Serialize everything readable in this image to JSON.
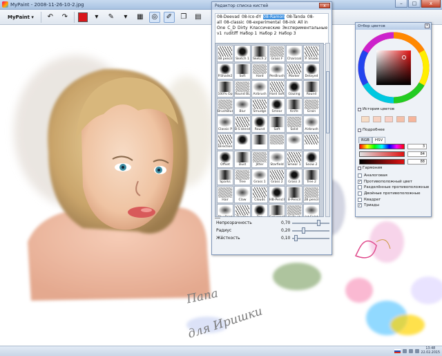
{
  "window": {
    "title": "MyPaint - 2008-11-26-10-2.jpg",
    "min": "–",
    "max": "□",
    "close": "x"
  },
  "toolbar": {
    "menu": "MyPaint ▾",
    "current_color": "#d9161b"
  },
  "canvas": {
    "line1": "Папа",
    "line2": "для Иришки"
  },
  "brush_dialog": {
    "title": "Редактор списка кистей",
    "groups": [
      "08-Deevad",
      "08-Ico-dY",
      "08-Ramon",
      "08-Tanda",
      "08-all",
      "08-classic",
      "08-experimental",
      "08-ink",
      "All in One",
      "C_D",
      "Dirty",
      "Классические",
      "Экспериментальные",
      "Любимые",
      "kaerhon v1",
      "ruditiff",
      "Набор 1",
      "Набор 2",
      "Набор 3"
    ],
    "selected_group": "08-Ramon",
    "brushes": [
      "48 pencil",
      "Sketch 1",
      "Sketch 2",
      "Grass F",
      "Charcoal",
      "P. Shade",
      "P.Shade2",
      "Soft",
      "Hard",
      "PenBrush",
      "Marker",
      "Delayed",
      "100% Op",
      "Round BL",
      "Airbrush",
      "Hard Soft",
      "Glazing",
      "Round",
      "BrushBlur",
      "Blur",
      "Smudge",
      "Smear",
      "Knife",
      "Grain",
      "Classic P",
      "B-S blend",
      "Round",
      "Soft",
      "Solid",
      "Airbrush",
      "Direction",
      "",
      "",
      "",
      "",
      "",
      "Offset",
      "Dust",
      "Jitter",
      "Starfield",
      "Smear 1",
      "Snow 2",
      "Sparks",
      "Tree",
      "Grass 1",
      "Grass 2",
      "Grass 3",
      "Tree 2",
      "Hair",
      "Claw",
      "Clouds",
      "HB-Pencil",
      "B-Pencil",
      "2B pencil",
      "BluePrint",
      "ThinPen",
      "Pen",
      "Calligraph",
      "Knife pt",
      "Jet Splat"
    ],
    "sliders": [
      {
        "label": "Непрозрачность",
        "value": "0,70",
        "pos": 0.7
      },
      {
        "label": "Радиус",
        "value": "0,20",
        "pos": 0.3
      },
      {
        "label": "Жёсткость",
        "value": "0,10",
        "pos": 0.1
      }
    ],
    "close": "x"
  },
  "color_dialog": {
    "title": "Отбор цветов",
    "history_label": "История цветов",
    "history": [
      "#f6ddc6",
      "#f7d3c3",
      "#f8d0c6",
      "#f4c0a9",
      "#f6b49a"
    ],
    "details_label": "Подробнее",
    "tabs": [
      "RGB",
      "HSV"
    ],
    "values": [
      "3",
      "84",
      "88"
    ],
    "harmony_label": "Гармония",
    "options": [
      {
        "label": "Аналоговая",
        "checked": false
      },
      {
        "label": "Противоположный цвет",
        "checked": true
      },
      {
        "label": "Разделённые противоположные",
        "checked": false
      },
      {
        "label": "Двойные противоположные",
        "checked": false
      },
      {
        "label": "Квадрат",
        "checked": false
      },
      {
        "label": "Триады",
        "checked": true
      }
    ],
    "close": "x"
  },
  "taskbar": {
    "time": "13:48",
    "date": "22.02.2015"
  },
  "colors": {
    "accent": "#3b8fe0",
    "selected": "#d9161b"
  }
}
